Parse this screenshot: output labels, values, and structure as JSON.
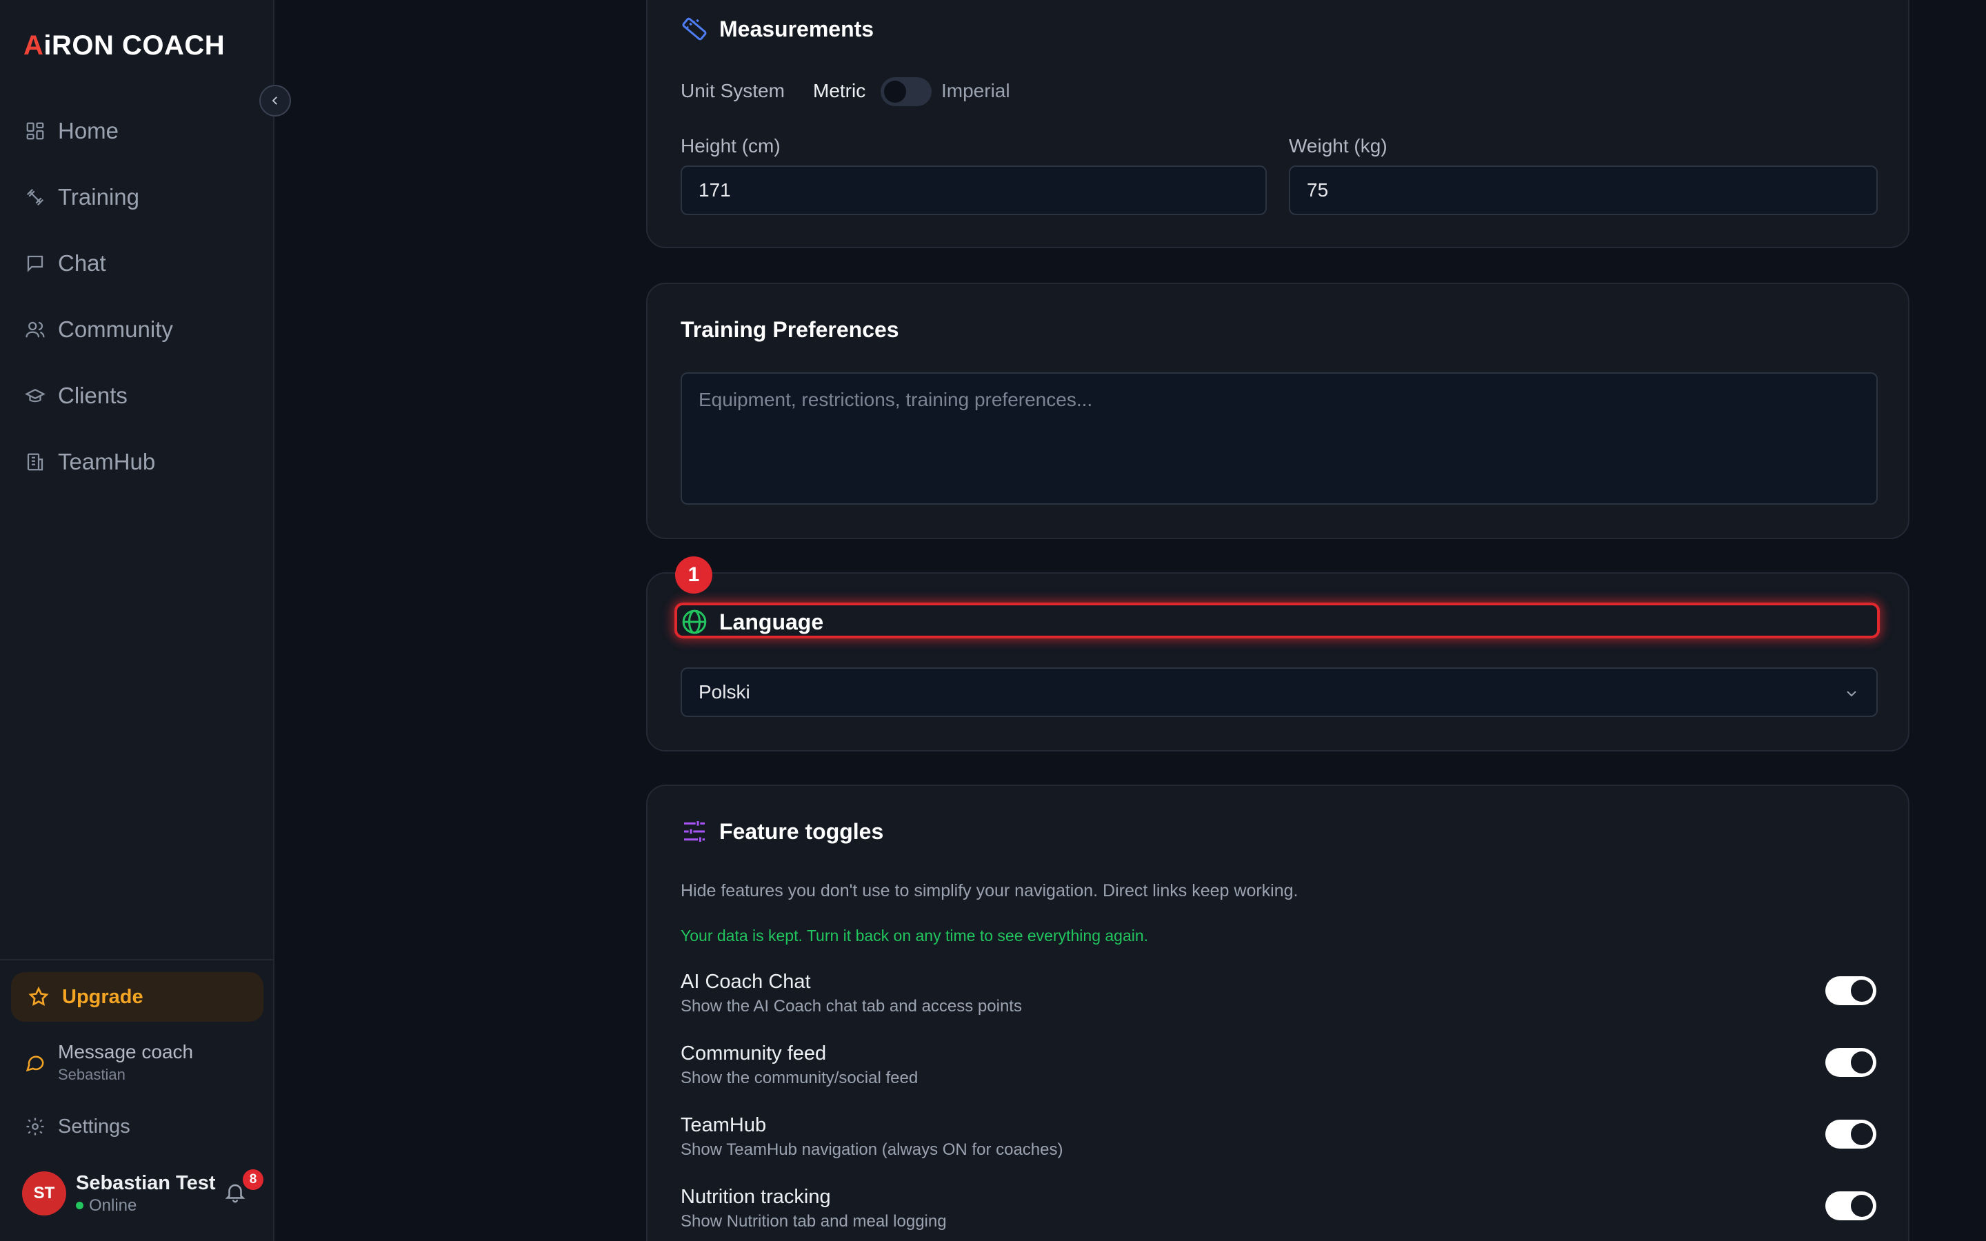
{
  "sidebar": {
    "logo": {
      "accent": "A",
      "rest": "iRON COACH"
    },
    "nav": [
      {
        "label": "Home",
        "icon": "grid-icon"
      },
      {
        "label": "Training",
        "icon": "dumbbell-icon"
      },
      {
        "label": "Chat",
        "icon": "chat-bubble-icon"
      },
      {
        "label": "Community",
        "icon": "users-icon"
      },
      {
        "label": "Clients",
        "icon": "graduation-cap-icon"
      },
      {
        "label": "TeamHub",
        "icon": "building-icon"
      }
    ],
    "upgrade_label": "Upgrade",
    "message_coach": {
      "label": "Message coach",
      "coach_name": "Sebastian"
    },
    "settings_label": "Settings",
    "user": {
      "initials": "ST",
      "name": "Sebastian Test",
      "status": "Online",
      "notifications": "8"
    }
  },
  "measurements": {
    "title": "Measurements",
    "unit_system_label": "Unit System",
    "metric_label": "Metric",
    "imperial_label": "Imperial",
    "imperial_enabled": false,
    "height_label": "Height (cm)",
    "height_value": "171",
    "weight_label": "Weight (kg)",
    "weight_value": "75"
  },
  "training_preferences": {
    "title": "Training Preferences",
    "placeholder": "Equipment, restrictions, training preferences..."
  },
  "language": {
    "marker": "1",
    "title": "Language",
    "selected": "Polski"
  },
  "feature_toggles": {
    "title": "Feature toggles",
    "description": "Hide features you don't use to simplify your navigation. Direct links keep working.",
    "note": "Your data is kept. Turn it back on any time to see everything again.",
    "items": [
      {
        "title": "AI Coach Chat",
        "desc": "Show the AI Coach chat tab and access points",
        "on": true
      },
      {
        "title": "Community feed",
        "desc": "Show the community/social feed",
        "on": true
      },
      {
        "title": "TeamHub",
        "desc": "Show TeamHub navigation (always ON for coaches)",
        "on": true
      },
      {
        "title": "Nutrition tracking",
        "desc": "Show Nutrition tab and meal logging",
        "on": true
      }
    ]
  },
  "colors": {
    "accent_red": "#e0282e",
    "upgrade_orange": "#f5a524",
    "success_green": "#22c55e",
    "measure_icon_blue": "#4f7df5",
    "language_icon_green": "#22c55e",
    "toggles_icon_purple": "#a855f7"
  }
}
